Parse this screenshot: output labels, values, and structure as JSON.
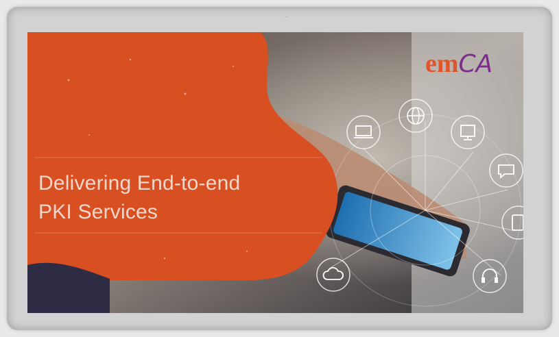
{
  "banner": {
    "headline_line1": "Delivering End-to-end",
    "headline_line2": "PKI Services",
    "logo": {
      "part1": "em",
      "part2": "CA"
    }
  },
  "colors": {
    "brand_orange": "#d84f22",
    "headline_text": "#f2d7cd",
    "logo_em": "#e1552c",
    "logo_ca": "#7a2d8a",
    "frame": "#d2d2d2"
  },
  "icons": [
    "laptop-icon",
    "globe-icon",
    "monitor-icon",
    "chat-icon",
    "cloud-icon",
    "headset-icon",
    "tablet-icon"
  ]
}
